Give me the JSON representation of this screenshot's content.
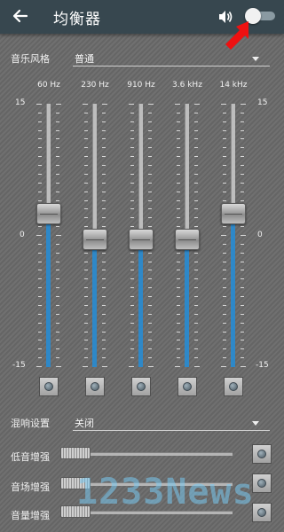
{
  "header": {
    "back_icon": "arrow-left-icon",
    "title": "均衡器",
    "volume_icon": "volume-icon",
    "power_toggle": {
      "state": "off"
    },
    "annotation_arrow_color": "#ee1111"
  },
  "preset": {
    "label": "音乐风格",
    "value": "普通"
  },
  "equalizer": {
    "scale_labels": {
      "max": "15",
      "mid": "0",
      "min": "-15"
    },
    "range_db": [
      -15,
      15
    ],
    "accent_color": "#2e88c8",
    "bands": [
      {
        "freq": "60 Hz",
        "level": 2.5
      },
      {
        "freq": "230 Hz",
        "level": -0.5
      },
      {
        "freq": "910 Hz",
        "level": -0.5
      },
      {
        "freq": "3.6 kHz",
        "level": -0.5
      },
      {
        "freq": "14 kHz",
        "level": 2.5
      }
    ]
  },
  "reverb": {
    "label": "混响设置",
    "value": "关闭"
  },
  "effects": [
    {
      "label": "低音增强",
      "level": 0
    },
    {
      "label": "音场增强",
      "level": 0
    },
    {
      "label": "音量增强",
      "level": 0
    }
  ],
  "watermark": "1233News"
}
